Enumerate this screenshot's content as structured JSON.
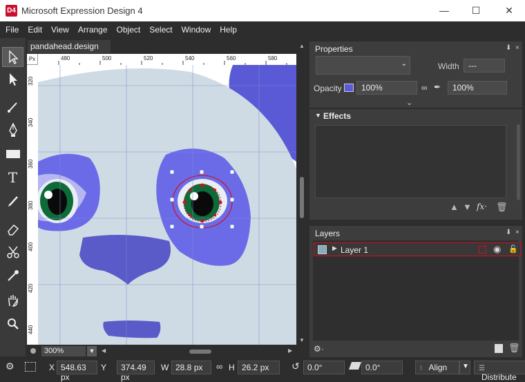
{
  "window": {
    "title": "Microsoft Expression Design 4",
    "app_icon": "D4"
  },
  "menu": [
    "File",
    "Edit",
    "View",
    "Arrange",
    "Object",
    "Select",
    "Window",
    "Help"
  ],
  "document": {
    "tab_label": "pandahead.design",
    "ruler_unit": "Px"
  },
  "ruler_h_ticks": [
    "480",
    "500",
    "520",
    "540",
    "560",
    "580"
  ],
  "ruler_v_ticks": [
    "320",
    "340",
    "360",
    "380",
    "400",
    "420",
    "440"
  ],
  "tools": [
    "selection-tool",
    "direct-selection-tool",
    "brush-tool",
    "pen-tool",
    "rectangle-tool",
    "text-tool",
    "paintbrush-tool",
    "eraser-tool",
    "scissors-tool",
    "eyedropper-tool",
    "hand-tool",
    "zoom-tool"
  ],
  "zoom": {
    "value": "300%"
  },
  "status": {
    "x_label": "X",
    "x_value": "548.63 px",
    "y_label": "Y",
    "y_value": "374.49 px",
    "w_label": "W",
    "w_value": "28.8 px",
    "h_label": "H",
    "h_value": "26.2 px",
    "rotate_value": "0.0°",
    "skew_value": "0.0°",
    "align_label": "Align",
    "distribute_label": "Distribute"
  },
  "properties": {
    "title": "Properties",
    "width_label": "Width",
    "width_value": "---",
    "opacity_label": "Opacity",
    "opacity_value": "100%",
    "opacity2_value": "100%"
  },
  "effects": {
    "title": "Effects"
  },
  "layers": {
    "title": "Layers",
    "items": [
      {
        "name": "Layer 1"
      }
    ]
  },
  "colors": {
    "accent_red": "#d01020",
    "panda_face": "#cfdbe4",
    "panda_purple": "#6060e0"
  }
}
